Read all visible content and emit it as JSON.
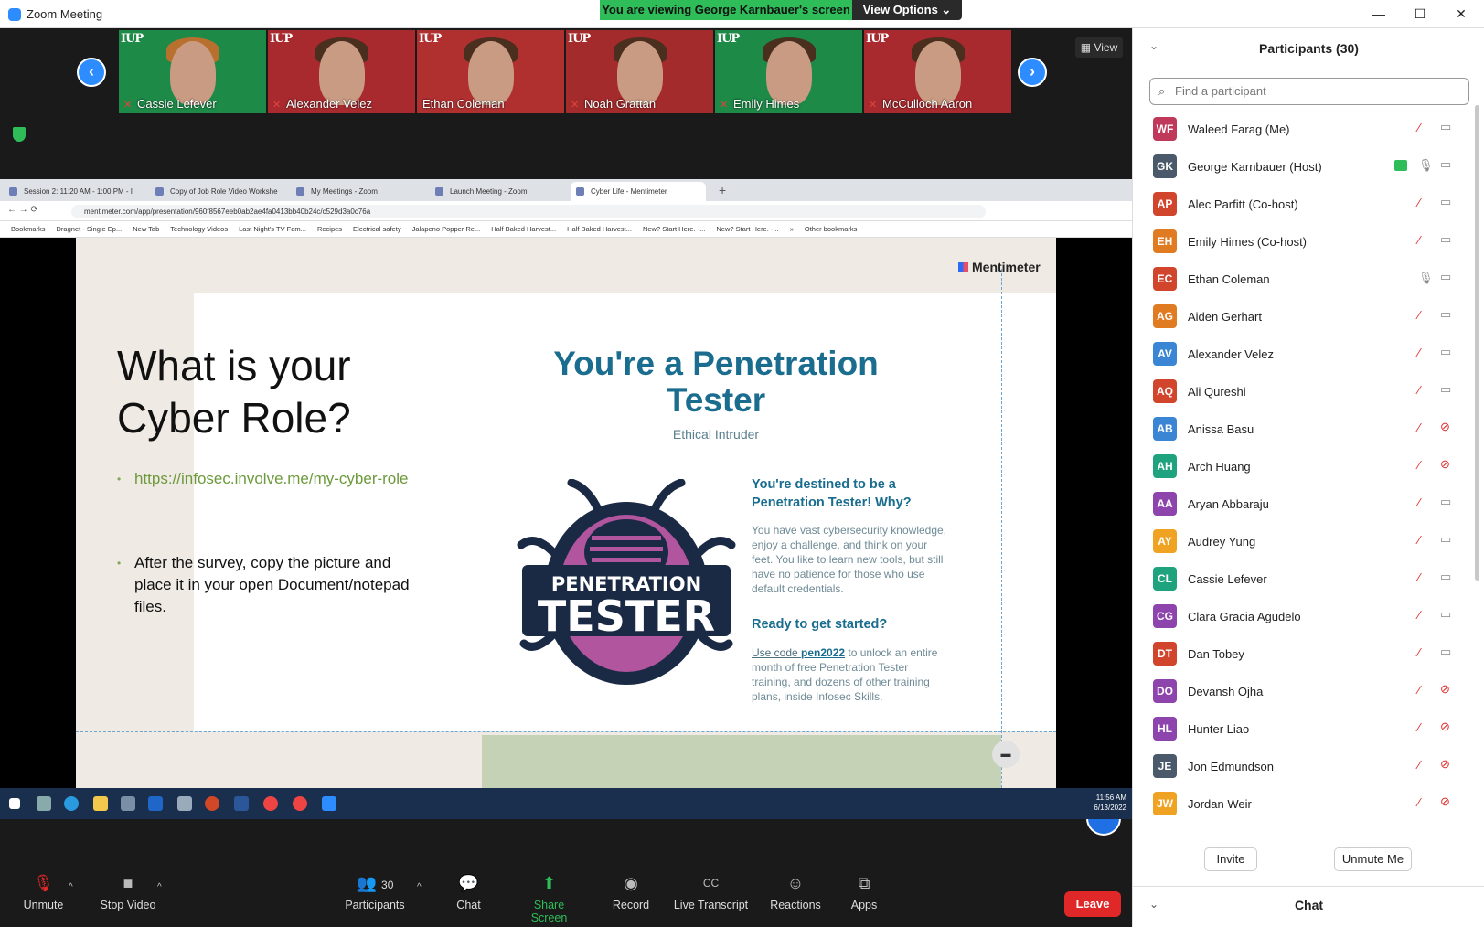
{
  "window": {
    "title": "Zoom Meeting",
    "minimize": "—",
    "maximize": "☐",
    "close": "✕"
  },
  "banner": {
    "viewing": "You are viewing George Karnbauer's screen",
    "view_options": "View Options ⌄"
  },
  "gallery": {
    "tiles": [
      {
        "name": "Cassie Lefever",
        "bg": "#1d8a47"
      },
      {
        "name": "Alexander Velez",
        "bg": "#a82a2e"
      },
      {
        "name": "Ethan Coleman",
        "bg": "#b03030"
      },
      {
        "name": "Noah Grattan",
        "bg": "#a42b2b"
      },
      {
        "name": "Emily Himes",
        "bg": "#1d8a47"
      },
      {
        "name": "McCulloch Aaron",
        "bg": "#a82a2e"
      }
    ],
    "logo_text": "IUP",
    "prev": "‹",
    "next": "›",
    "view_label": "View"
  },
  "browser": {
    "tabs": [
      {
        "label": "Session 2: 11:20 AM - 1:00 PM - I"
      },
      {
        "label": "Copy of Job Role Video Workshe"
      },
      {
        "label": "My Meetings - Zoom"
      },
      {
        "label": "Launch Meeting - Zoom"
      },
      {
        "label": "Cyber Life - Mentimeter"
      }
    ],
    "url": "mentimeter.com/app/presentation/960f8567eeb0ab2ae4fa0413bb40b24c/c529d3a0c76a",
    "bookmarks": [
      "Bookmarks",
      "Dragnet - Single Ep...",
      "New Tab",
      "Technology Videos",
      "Last Night's TV Fam...",
      "Recipes",
      "Electrical safety",
      "Jalapeno Popper Re...",
      "Half Baked Harvest...",
      "Half Baked Harvest...",
      "New? Start Here. -...",
      "New? Start Here. -...",
      "»",
      "Other bookmarks"
    ]
  },
  "slide": {
    "brand": "Mentimeter",
    "question": "What is your Cyber Role?",
    "link": "https://infosec.involve.me/my-cyber-role",
    "instruction": "After the survey, copy the picture and place it in your open Document/notepad files.",
    "result_title": "You're a Penetration Tester",
    "result_subtitle": "Ethical Intruder",
    "badge_line1": "PENETRATION",
    "badge_line2": "TESTER",
    "why_heading": "You're destined to be a Penetration Tester! Why?",
    "why_body": "You have vast cybersecurity knowledge, enjoy a challenge, and think on your feet. You like to learn new tools, but still have no patience for those who use default credentials.",
    "ready_heading": "Ready to get started?",
    "code_pre": "Use code ",
    "code": "pen2022",
    "code_post": " to unlock an entire month of free Penetration Tester training, and dozens of other training plans, inside Infosec Skills."
  },
  "taskbar": {
    "time": "11:56 AM",
    "date": "6/13/2022"
  },
  "toolbar": {
    "unmute": "Unmute",
    "stop_video": "Stop Video",
    "participants": "Participants",
    "participants_count": "30",
    "chat": "Chat",
    "share_screen": "Share Screen",
    "record": "Record",
    "live_transcript": "Live Transcript",
    "reactions": "Reactions",
    "apps": "Apps",
    "leave": "Leave"
  },
  "panel": {
    "title": "Participants (30)",
    "search_placeholder": "Find a participant",
    "participants": [
      {
        "initials": "WF",
        "name": "Waleed Farag (Me)",
        "color": "#c0395a",
        "mic": "muted",
        "cam": "on"
      },
      {
        "initials": "GK",
        "name": "George Karnbauer (Host)",
        "color": "#4a5a6a",
        "mic": "on",
        "cam": "on",
        "sharing": true
      },
      {
        "initials": "AP",
        "name": "Alec Parfitt (Co-host)",
        "color": "#d2452d",
        "mic": "muted",
        "cam": "on"
      },
      {
        "initials": "EH",
        "name": "Emily Himes (Co-host)",
        "color": "#e07b22",
        "mic": "muted",
        "cam": "on"
      },
      {
        "initials": "EC",
        "name": "Ethan Coleman",
        "color": "#d2452d",
        "mic": "on",
        "cam": "on"
      },
      {
        "initials": "AG",
        "name": "Aiden Gerhart",
        "color": "#e07b22",
        "mic": "muted",
        "cam": "on"
      },
      {
        "initials": "AV",
        "name": "Alexander Velez",
        "color": "#3b86d4",
        "mic": "muted",
        "cam": "on"
      },
      {
        "initials": "AQ",
        "name": "Ali Qureshi",
        "color": "#d2452d",
        "mic": "muted",
        "cam": "on"
      },
      {
        "initials": "AB",
        "name": "Anissa Basu",
        "color": "#3b86d4",
        "mic": "muted",
        "cam": "off"
      },
      {
        "initials": "AH",
        "name": "Arch Huang",
        "color": "#1fa37e",
        "mic": "muted",
        "cam": "off"
      },
      {
        "initials": "AA",
        "name": "Aryan Abbaraju",
        "color": "#8e44ad",
        "mic": "muted",
        "cam": "on"
      },
      {
        "initials": "AY",
        "name": "Audrey Yung",
        "color": "#f0a322",
        "mic": "muted",
        "cam": "on"
      },
      {
        "initials": "CL",
        "name": "Cassie Lefever",
        "color": "#1fa37e",
        "mic": "muted",
        "cam": "on"
      },
      {
        "initials": "CG",
        "name": "Clara Gracia Agudelo",
        "color": "#8e44ad",
        "mic": "muted",
        "cam": "on"
      },
      {
        "initials": "DT",
        "name": "Dan Tobey",
        "color": "#d2452d",
        "mic": "muted",
        "cam": "on"
      },
      {
        "initials": "DO",
        "name": "Devansh Ojha",
        "color": "#8e44ad",
        "mic": "muted",
        "cam": "off"
      },
      {
        "initials": "HL",
        "name": "Hunter Liao",
        "color": "#8e44ad",
        "mic": "muted",
        "cam": "off"
      },
      {
        "initials": "JE",
        "name": "Jon Edmundson",
        "color": "#4a5a6a",
        "mic": "muted",
        "cam": "off"
      },
      {
        "initials": "JW",
        "name": "Jordan Weir",
        "color": "#f0a322",
        "mic": "muted",
        "cam": "off"
      }
    ],
    "invite": "Invite",
    "unmute_me": "Unmute Me",
    "chat": "Chat"
  }
}
